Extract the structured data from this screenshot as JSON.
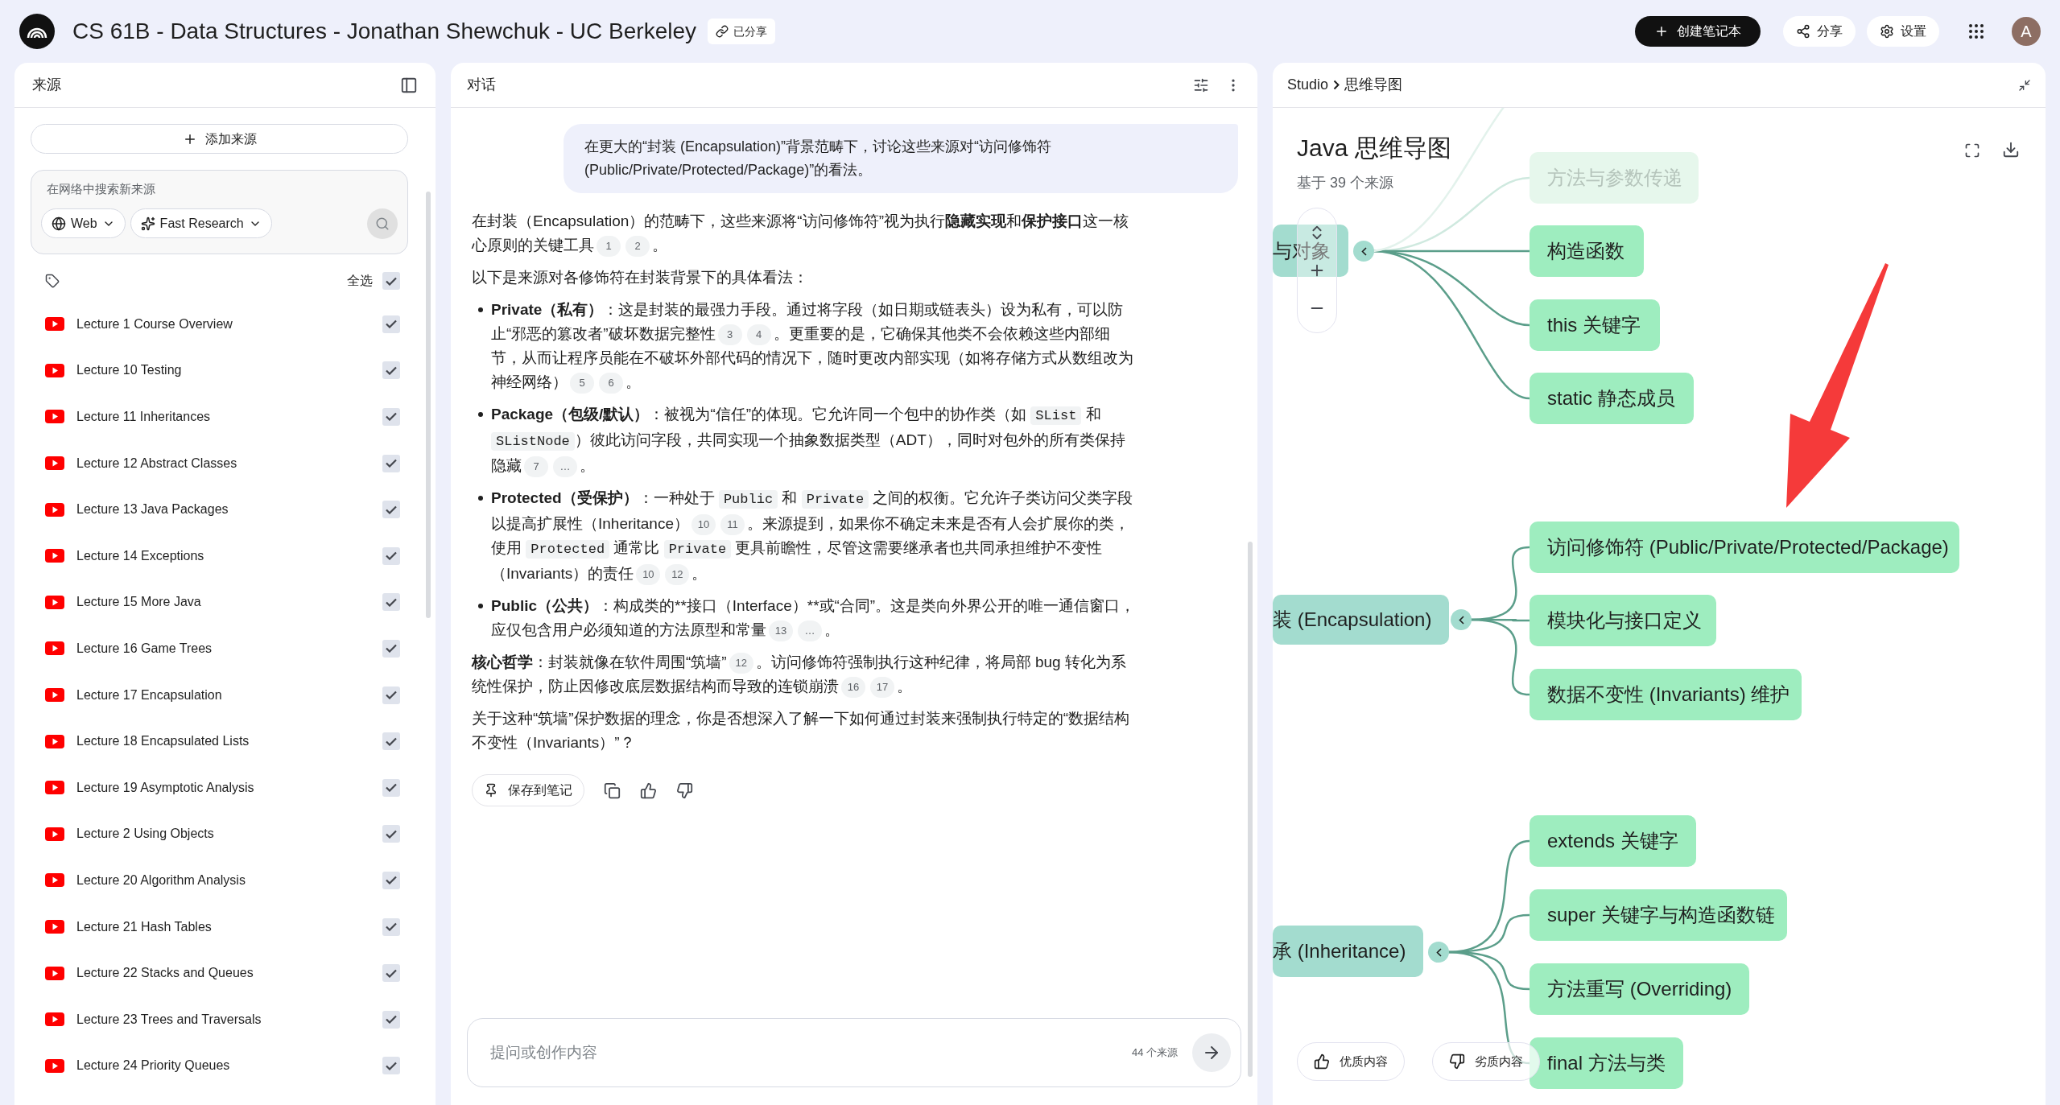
{
  "topbar": {
    "title": "CS 61B - Data Structures - Jonathan Shewchuk - UC Berkeley",
    "shared_badge": "已分享",
    "create_button": "创建笔记本",
    "share_button": "分享",
    "settings_button": "设置",
    "avatar": "A"
  },
  "sources": {
    "title": "来源",
    "add_button": "添加来源",
    "search_placeholder": "在网络中搜索新来源",
    "web_dropdown": "Web",
    "mode_dropdown": "Fast Research",
    "select_all": {
      "label": "全选",
      "checked": true
    },
    "items": [
      {
        "label": "Lecture 1 Course Overview",
        "checked": true
      },
      {
        "label": "Lecture 10 Testing",
        "checked": true
      },
      {
        "label": "Lecture 11 Inheritances",
        "checked": true
      },
      {
        "label": "Lecture 12 Abstract Classes",
        "checked": true
      },
      {
        "label": "Lecture 13 Java Packages",
        "checked": true
      },
      {
        "label": "Lecture 14 Exceptions",
        "checked": true
      },
      {
        "label": "Lecture 15 More Java",
        "checked": true
      },
      {
        "label": "Lecture 16 Game Trees",
        "checked": true
      },
      {
        "label": "Lecture 17 Encapsulation",
        "checked": true
      },
      {
        "label": "Lecture 18 Encapsulated Lists",
        "checked": true
      },
      {
        "label": "Lecture 19 Asymptotic Analysis",
        "checked": true
      },
      {
        "label": "Lecture 2 Using Objects",
        "checked": true
      },
      {
        "label": "Lecture 20 Algorithm Analysis",
        "checked": true
      },
      {
        "label": "Lecture 21 Hash Tables",
        "checked": true
      },
      {
        "label": "Lecture 22 Stacks and Queues",
        "checked": true
      },
      {
        "label": "Lecture 23 Trees and Traversals",
        "checked": true
      },
      {
        "label": "Lecture 24 Priority Queues",
        "checked": true
      }
    ]
  },
  "chat": {
    "title": "对话",
    "user_message": "在更大的“封装 (Encapsulation)”背景范畴下，讨论这些来源对“访问修饰符 (Public/Private/Protected/Package)”的看法。",
    "answer": [
      {
        "kind": "paragraph",
        "segments": [
          {
            "kind": "text",
            "text": "在封装（Encapsulation）的范畴下，这些来源将“访问修饰符”视为执行"
          },
          {
            "kind": "bold",
            "text": "隐藏实现"
          },
          {
            "kind": "text",
            "text": "和"
          },
          {
            "kind": "bold",
            "text": "保护接口"
          },
          {
            "kind": "text",
            "text": "这一核心原则的关键工具"
          },
          {
            "kind": "cite",
            "text": "1"
          },
          {
            "kind": "cite",
            "text": "2"
          },
          {
            "kind": "text",
            "text": "。"
          }
        ]
      },
      {
        "kind": "paragraph",
        "segments": [
          {
            "kind": "text",
            "text": "以下是来源对各修饰符在封装背景下的具体看法："
          }
        ]
      },
      {
        "kind": "bullet",
        "segments": [
          {
            "kind": "bold",
            "text": "Private（私有）"
          },
          {
            "kind": "text",
            "text": "：这是封装的最强力手段。通过将字段（如日期或链表头）设为私有，可以防止“邪恶的篡改者”破坏数据完整性"
          },
          {
            "kind": "cite",
            "text": "3"
          },
          {
            "kind": "cite",
            "text": "4"
          },
          {
            "kind": "text",
            "text": "。更重要的是，它确保其他类不会依赖这些内部细节，从而让程序员能在不破坏外部代码的情况下，随时更改内部实现（如将存储方式从数组改为神经网络）"
          },
          {
            "kind": "cite",
            "text": "5"
          },
          {
            "kind": "cite",
            "text": "6"
          },
          {
            "kind": "text",
            "text": "。"
          }
        ]
      },
      {
        "kind": "bullet",
        "segments": [
          {
            "kind": "bold",
            "text": "Package（包级/默认）"
          },
          {
            "kind": "text",
            "text": "：被视为“信任”的体现。它允许同一个包中的协作类（如 "
          },
          {
            "kind": "code",
            "text": "SList"
          },
          {
            "kind": "text",
            "text": " 和 "
          },
          {
            "kind": "code",
            "text": "SListNode"
          },
          {
            "kind": "text",
            "text": "）彼此访问字段，共同实现一个抽象数据类型（ADT），同时对包外的所有类保持隐藏"
          },
          {
            "kind": "cite",
            "text": "7"
          },
          {
            "kind": "cite",
            "text": "…"
          },
          {
            "kind": "text",
            "text": "。"
          }
        ]
      },
      {
        "kind": "bullet",
        "segments": [
          {
            "kind": "bold",
            "text": "Protected（受保护）"
          },
          {
            "kind": "text",
            "text": "：一种处于 "
          },
          {
            "kind": "code",
            "text": "Public"
          },
          {
            "kind": "text",
            "text": " 和 "
          },
          {
            "kind": "code",
            "text": "Private"
          },
          {
            "kind": "text",
            "text": " 之间的权衡。它允许子类访问父类字段以提高扩展性（Inheritance）"
          },
          {
            "kind": "cite",
            "text": "10"
          },
          {
            "kind": "cite",
            "text": "11"
          },
          {
            "kind": "text",
            "text": "。来源提到，如果你不确定未来是否有人会扩展你的类，使用 "
          },
          {
            "kind": "code",
            "text": "Protected"
          },
          {
            "kind": "text",
            "text": " 通常比 "
          },
          {
            "kind": "code",
            "text": "Private"
          },
          {
            "kind": "text",
            "text": " 更具前瞻性，尽管这需要继承者也共同承担维护不变性（Invariants）的责任"
          },
          {
            "kind": "cite",
            "text": "10"
          },
          {
            "kind": "cite",
            "text": "12"
          },
          {
            "kind": "text",
            "text": "。"
          }
        ]
      },
      {
        "kind": "bullet",
        "segments": [
          {
            "kind": "bold",
            "text": "Public（公共）"
          },
          {
            "kind": "text",
            "text": "：构成类的**接口（Interface）**或“合同”。这是类向外界公开的唯一通信窗口，应仅包含用户必须知道的方法原型和常量"
          },
          {
            "kind": "cite",
            "text": "13"
          },
          {
            "kind": "cite",
            "text": "…"
          },
          {
            "kind": "text",
            "text": "。"
          }
        ]
      },
      {
        "kind": "paragraph",
        "segments": [
          {
            "kind": "bold",
            "text": "核心哲学"
          },
          {
            "kind": "text",
            "text": "：封装就像在软件周围“筑墙”"
          },
          {
            "kind": "cite",
            "text": "12"
          },
          {
            "kind": "text",
            "text": "。访问修饰符强制执行这种纪律，将局部 bug 转化为系统性保护，防止因修改底层数据结构而导致的连锁崩溃"
          },
          {
            "kind": "cite",
            "text": "16"
          },
          {
            "kind": "cite",
            "text": "17"
          },
          {
            "kind": "text",
            "text": "。"
          }
        ]
      },
      {
        "kind": "paragraph",
        "segments": [
          {
            "kind": "text",
            "text": "关于这种“筑墙”保护数据的理念，你是否想深入了解一下如何通过封装来强制执行特定的“数据结构不变性（Invariants）”？"
          }
        ]
      }
    ],
    "save_button": "保存到笔记",
    "input_placeholder": "提问或创作内容",
    "source_count": "44 个来源"
  },
  "studio": {
    "breadcrumb": [
      "Studio",
      "思维导图"
    ],
    "title": "Java 思维导图",
    "subtitle": "基于 39 个来源",
    "mindmap": [
      {
        "label": "与对象",
        "children": [
          {
            "label": "方法与参数传递",
            "faded": true
          },
          {
            "label": "构造函数",
            "faded": false
          },
          {
            "label": "this 关键字",
            "faded": false
          },
          {
            "label": "static 静态成员",
            "faded": false
          }
        ]
      },
      {
        "label": "装 (Encapsulation)",
        "children": [
          {
            "label": "访问修饰符 (Public/Private/Protected/Package)",
            "faded": false
          },
          {
            "label": "模块化与接口定义",
            "faded": false
          },
          {
            "label": "数据不变性 (Invariants) 维护",
            "faded": false
          }
        ]
      },
      {
        "label": "承 (Inheritance)",
        "children": [
          {
            "label": "extends 关键字",
            "faded": false
          },
          {
            "label": "super 关键字与构造函数链",
            "faded": false
          },
          {
            "label": "方法重写 (Overriding)",
            "faded": false
          },
          {
            "label": "final 方法与类",
            "faded": false
          }
        ]
      }
    ],
    "good_button": "优质内容",
    "bad_button": "劣质内容"
  }
}
